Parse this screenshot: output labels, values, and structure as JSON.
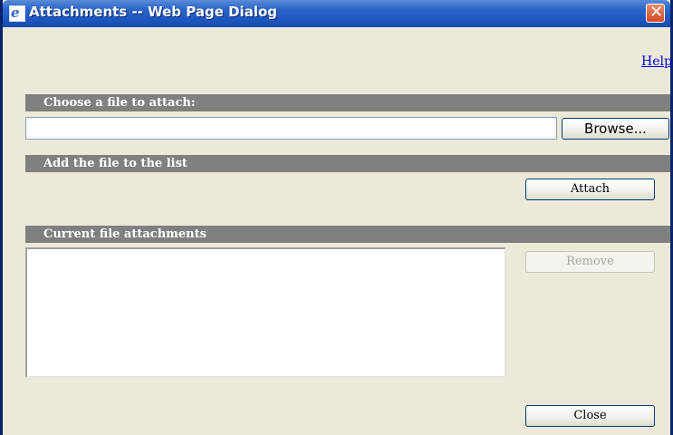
{
  "window": {
    "title": "Attachments -- Web Page Dialog",
    "close_glyph": "✕",
    "icon": "ie-icon"
  },
  "help_link": "Help",
  "sections": {
    "choose_file": "Choose a file to attach:",
    "add_file": "Add the file to the list",
    "current_attachments": "Current file attachments"
  },
  "file_input": {
    "value": "",
    "placeholder": ""
  },
  "buttons": {
    "browse": "Browse...",
    "attach": "Attach",
    "remove": "Remove",
    "close": "Close"
  },
  "attachments": [],
  "colors": {
    "titlebar": "#2a64c8",
    "dialog_background": "#ece9d8",
    "section_header": "#808080",
    "link": "#0000ee"
  }
}
